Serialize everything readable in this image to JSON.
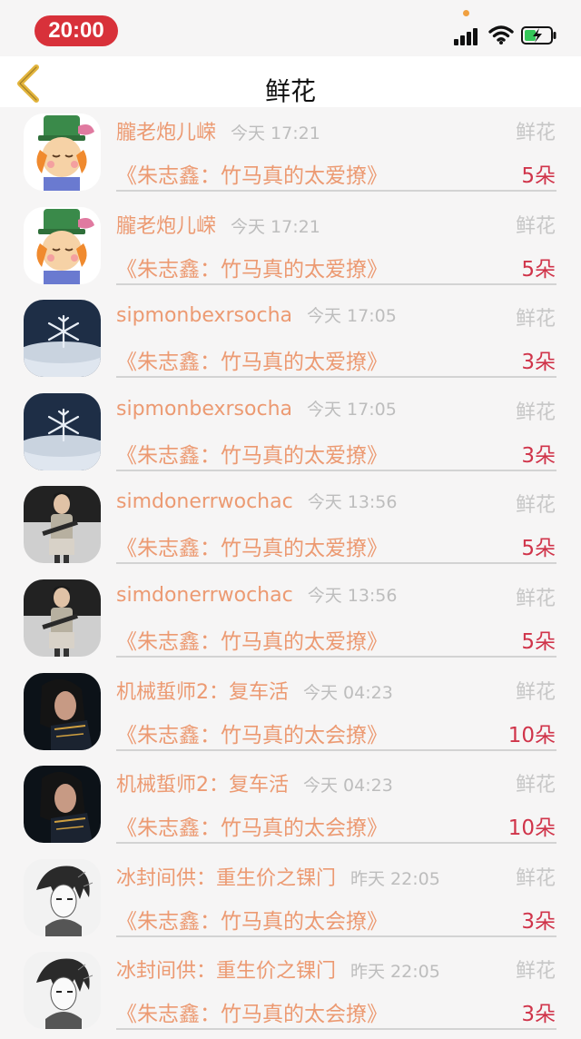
{
  "status_bar": {
    "time": "20:00"
  },
  "header": {
    "title": "鲜花"
  },
  "rows": [
    {
      "sender": "朧老炮儿嵘",
      "time": "今天 17:21",
      "gift": "鲜花",
      "work": "《朱志鑫：竹马真的太爱撩》",
      "count": "5朵",
      "avatar": "cartoon-avatar"
    },
    {
      "sender": "朧老炮儿嵘",
      "time": "今天 17:21",
      "gift": "鲜花",
      "work": "《朱志鑫：竹马真的太爱撩》",
      "count": "5朵",
      "avatar": "cartoon-avatar"
    },
    {
      "sender": "sipmonbexrsocha",
      "time": "今天 17:05",
      "gift": "鲜花",
      "work": "《朱志鑫：竹马真的太爱撩》",
      "count": "3朵",
      "avatar": "snowflake-avatar"
    },
    {
      "sender": "sipmonbexrsocha",
      "time": "今天 17:05",
      "gift": "鲜花",
      "work": "《朱志鑫：竹马真的太爱撩》",
      "count": "3朵",
      "avatar": "snowflake-avatar"
    },
    {
      "sender": "simdonerrwochac",
      "time": "今天 13:56",
      "gift": "鲜花",
      "work": "《朱志鑫：竹马真的太爱撩》",
      "count": "5朵",
      "avatar": "soldier-avatar"
    },
    {
      "sender": "simdonerrwochac",
      "time": "今天 13:56",
      "gift": "鲜花",
      "work": "《朱志鑫：竹马真的太爱撩》",
      "count": "5朵",
      "avatar": "soldier-avatar"
    },
    {
      "sender": "机械蜇师2：复车活",
      "time": "今天 04:23",
      "gift": "鲜花",
      "work": "《朱志鑫：竹马真的太会撩》",
      "count": "10朵",
      "avatar": "dark-portrait-avatar"
    },
    {
      "sender": "机械蜇师2：复车活",
      "time": "今天 04:23",
      "gift": "鲜花",
      "work": "《朱志鑫：竹马真的太会撩》",
      "count": "10朵",
      "avatar": "dark-portrait-avatar"
    },
    {
      "sender": "冰封间供：重生价之锞门",
      "time": "昨天 22:05",
      "gift": "鲜花",
      "work": "《朱志鑫：竹马真的太会撩》",
      "count": "3朵",
      "avatar": "sketch-avatar"
    },
    {
      "sender": "冰封间供：重生价之锞门",
      "time": "昨天 22:05",
      "gift": "鲜花",
      "work": "《朱志鑫：竹马真的太会撩》",
      "count": "3朵",
      "avatar": "sketch-avatar"
    }
  ],
  "colors": {
    "accent": "#ec9a72",
    "count": "#d0344a",
    "time_pill": "#d8313a",
    "back_icon": "#e2b43c"
  }
}
